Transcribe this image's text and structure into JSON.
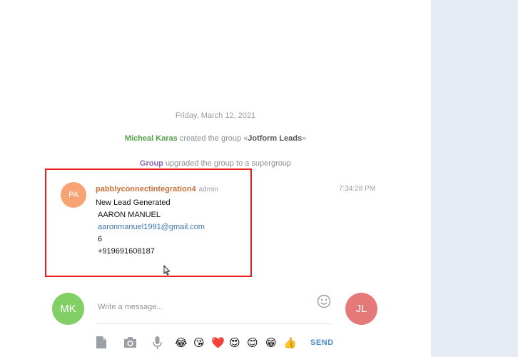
{
  "chat": {
    "date_separator": "Friday, March 12, 2021",
    "service_messages": [
      {
        "actor": "Micheal Karas",
        "text_before": " created the group «",
        "group": "Jotform Leads",
        "text_after": "»"
      },
      {
        "actor": "Group",
        "text": " upgraded the group to a supergroup"
      }
    ],
    "message": {
      "avatar_initials": "PA",
      "sender": "pabblyconnectintegration4",
      "role": "admin",
      "time": "7:34:28 PM",
      "lines": [
        "New Lead Generated",
        "AARON MANUEL",
        "aaronmanuel1991@gmail.com",
        "6",
        "+919691608187"
      ]
    }
  },
  "composer": {
    "placeholder": "Write a message...",
    "my_avatar": "MK",
    "peer_avatar": "JL",
    "send_label": "SEND",
    "emojis": [
      "😂",
      "😘",
      "❤️",
      "😍",
      "😊",
      "😁",
      "👍"
    ]
  },
  "colors": {
    "highlight": "#ef1c1c",
    "avatar_pa": "#f7a373",
    "avatar_mk": "#82cf66",
    "avatar_jl": "#e57979",
    "link": "#3e75b3"
  }
}
